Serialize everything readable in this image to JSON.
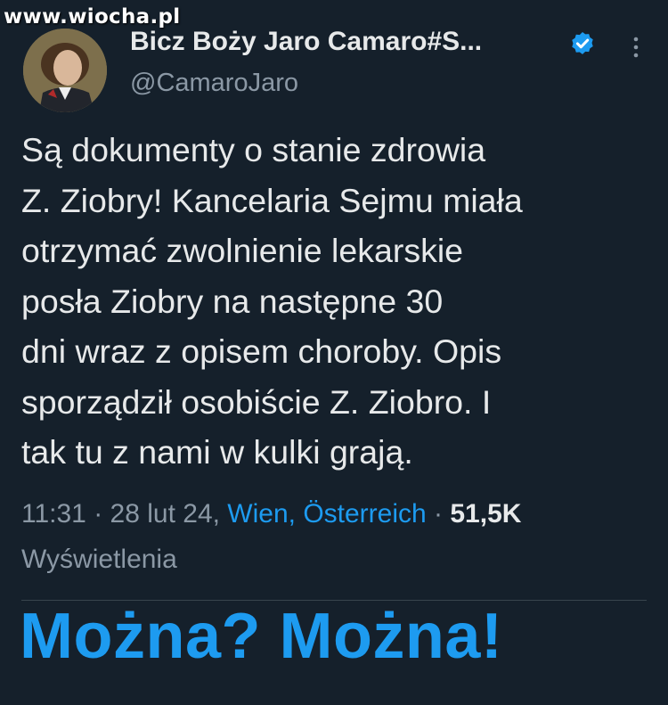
{
  "watermark": "www.wiocha.pl",
  "tweet": {
    "author": {
      "display_name": "Bicz Boży Jaro Camaro#S...",
      "handle": "@CamaroJaro",
      "verified": true
    },
    "text_lines": [
      "Są dokumenty o stanie zdrowia",
      "Z. Ziobry! Kancelaria Sejmu miała",
      "otrzymać zwolnienie lekarskie",
      "posła Ziobry na następne 30",
      "dni wraz z opisem choroby. Opis",
      "sporządził osobiście Z. Ziobro. I",
      "tak tu z nami w kulki grają."
    ],
    "meta": {
      "time": "11:31",
      "date": "28 lut 24",
      "location": "Wien, Österreich",
      "views": "51,5K",
      "views_label": "Wyświetlenia"
    }
  },
  "caption": "Można? Można!",
  "icons": [
    "verified-badge-icon",
    "more-options-icon"
  ],
  "colors": {
    "background": "#15202b",
    "text": "#e7e9ea",
    "secondary": "#8b98a5",
    "accent": "#1d9bf0"
  }
}
